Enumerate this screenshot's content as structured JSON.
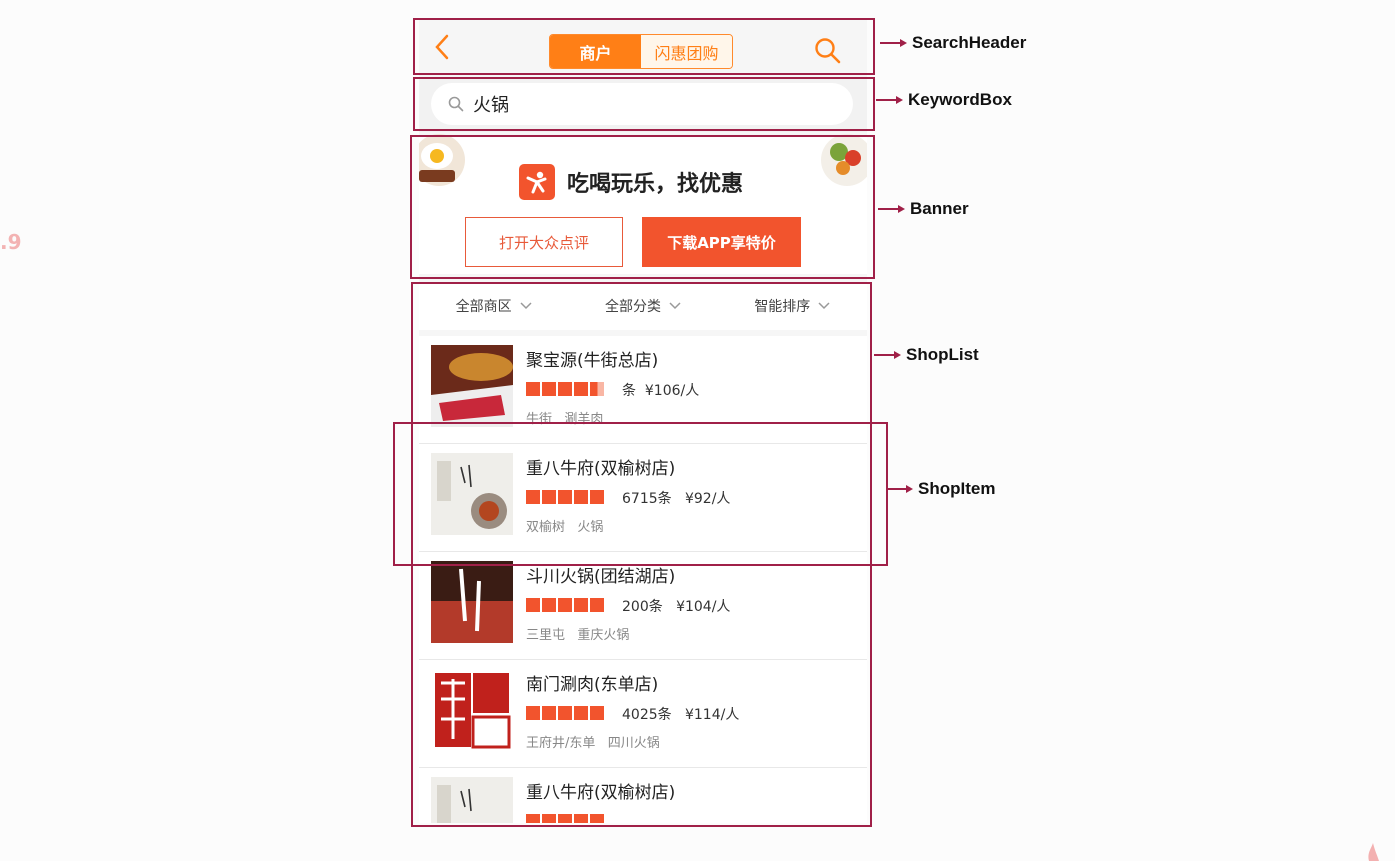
{
  "side_number": ".9",
  "header": {
    "tabs": [
      {
        "label": "商户",
        "active": true
      },
      {
        "label": "闪惠团购",
        "active": false
      }
    ]
  },
  "keyword_box": {
    "value": "火锅"
  },
  "banner": {
    "slogan": "吃喝玩乐，找优惠",
    "open_button": "打开大众点评",
    "download_button": "下载APP享特价"
  },
  "filters": [
    "全部商区",
    "全部分类",
    "智能排序"
  ],
  "shops": [
    {
      "name": "聚宝源(牛街总店)",
      "rating": 4.5,
      "meta": "条  ¥106/人",
      "tags": "牛街   涮羊肉"
    },
    {
      "name": "重八牛府(双榆树店)",
      "rating": 5,
      "meta": "6715条   ¥92/人",
      "tags": "双榆树   火锅"
    },
    {
      "name": "斗川火锅(团结湖店)",
      "rating": 5,
      "meta": "200条   ¥104/人",
      "tags": "三里屯   重庆火锅"
    },
    {
      "name": "南门涮肉(东单店)",
      "rating": 5,
      "meta": "4025条   ¥114/人",
      "tags": "王府井/东单   四川火锅"
    },
    {
      "name": "重八牛府(双榆树店)",
      "rating": 5,
      "meta": "",
      "tags": ""
    }
  ],
  "annotations": {
    "search_header": "SearchHeader",
    "keyword_box": "KeywordBox",
    "banner": "Banner",
    "shop_list": "ShopList",
    "shop_item": "ShopItem"
  },
  "colors": {
    "accent_orange": "#ff7f16",
    "brand_red": "#f2542d",
    "annotation_frame": "#a02048"
  }
}
